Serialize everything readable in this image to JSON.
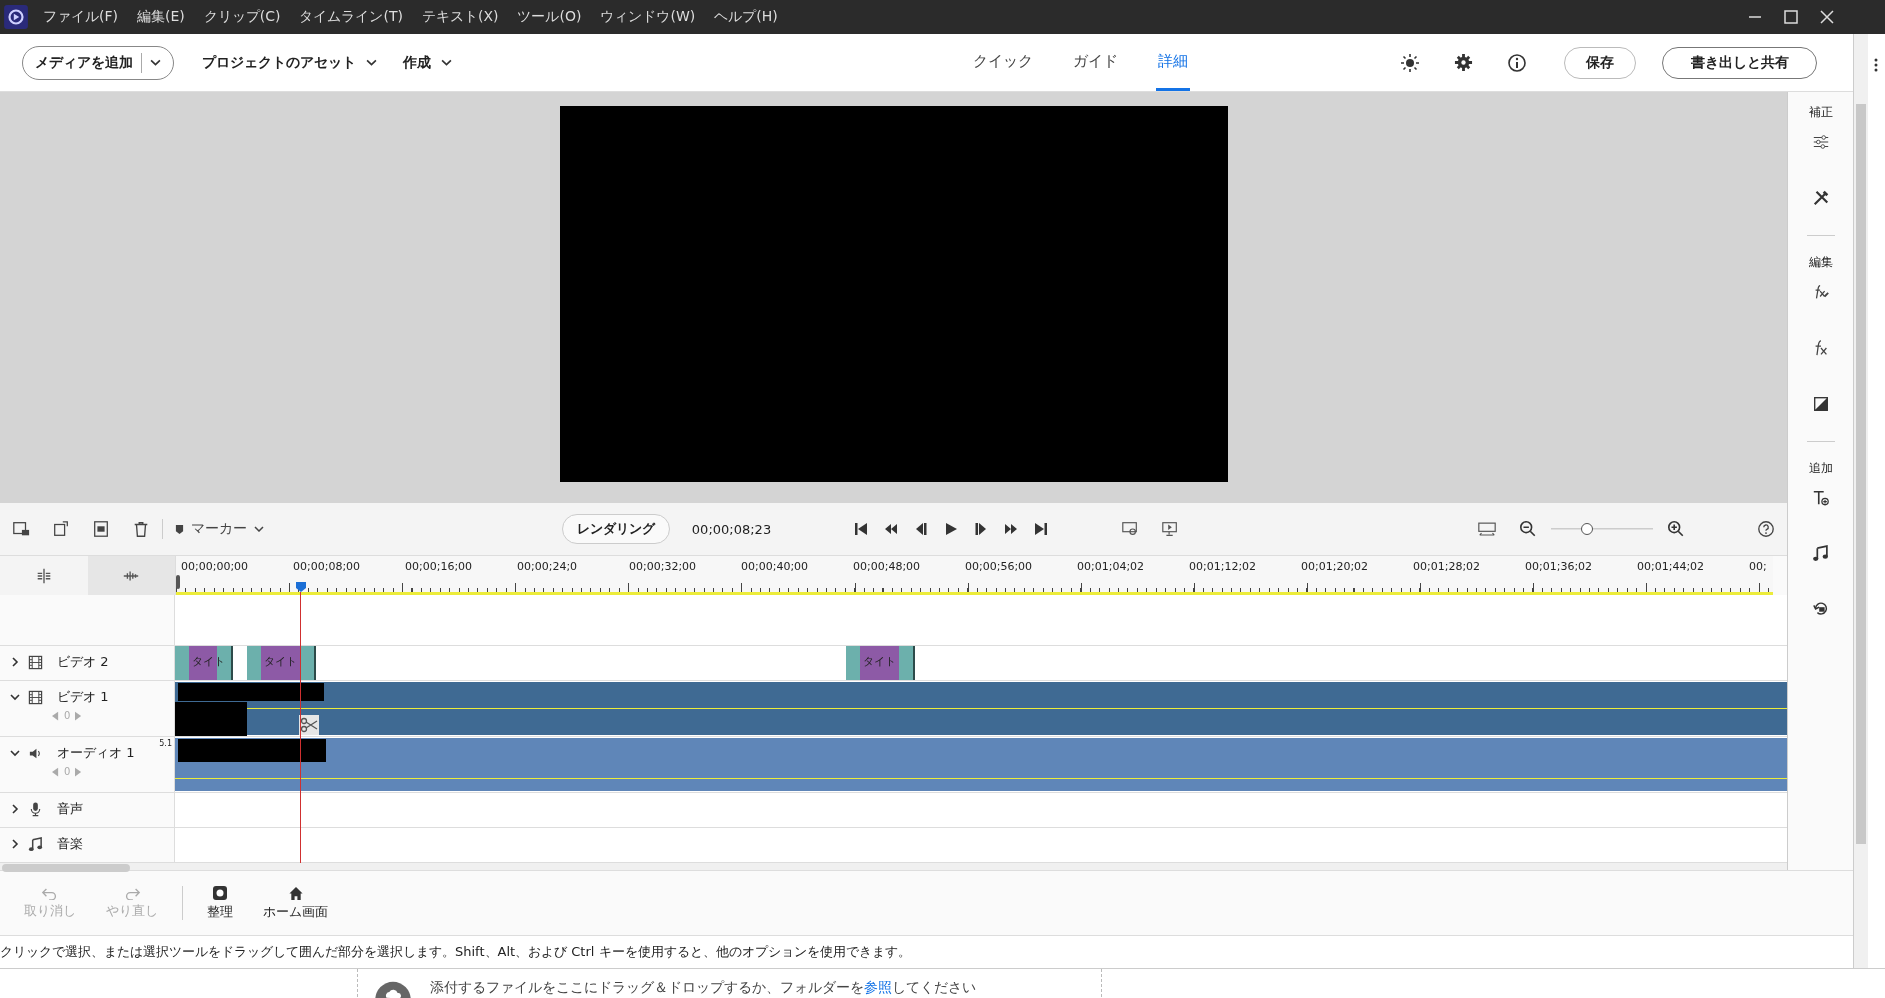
{
  "menu_bar": {
    "items": [
      "ファイル(F)",
      "編集(E)",
      "クリップ(C)",
      "タイムライン(T)",
      "テキスト(X)",
      "ツール(O)",
      "ウィンドウ(W)",
      "ヘルプ(H)"
    ]
  },
  "toolbar": {
    "add_media": "メディアを追加",
    "project_assets": "プロジェクトのアセット",
    "create": "作成",
    "save": "保存",
    "export": "書き出しと共有"
  },
  "mode_tabs": [
    {
      "label": "クイック",
      "selected": false
    },
    {
      "label": "ガイド",
      "selected": false
    },
    {
      "label": "詳細",
      "selected": true
    }
  ],
  "right_panel": {
    "sections": [
      {
        "label": "補正",
        "tools": [
          {
            "kind": "sliders"
          },
          {
            "kind": "tools"
          }
        ]
      },
      {
        "label": "編集",
        "tools": [
          {
            "kind": "fx-pen"
          },
          {
            "kind": "fx"
          },
          {
            "kind": "contrast"
          }
        ]
      },
      {
        "label": "追加",
        "tools": [
          {
            "kind": "text"
          },
          {
            "kind": "music"
          },
          {
            "kind": "rotate"
          }
        ]
      }
    ]
  },
  "timeline_toolbar": {
    "marker": "マーカー",
    "render": "レンダリング",
    "timecode": "00;00;08;23",
    "zoom": {
      "level": 0.35
    }
  },
  "ruler": [
    "00;00;00;00",
    "00;00;08;00",
    "00;00;16;00",
    "00;00;24;0",
    "00;00;32;00",
    "00;00;40;00",
    "00;00;48;00",
    "00;00;56;00",
    "00;01;04;02",
    "00;01;12;02",
    "00;01;20;02",
    "00;01;28;02",
    "00;01;36;02",
    "00;01;44;02",
    "00;"
  ],
  "tracks": [
    {
      "kind": "video",
      "name": "ビデオ 2",
      "expanded": false,
      "clips": [
        {
          "label": "タイト"
        },
        {
          "label": "タイト"
        },
        {
          "label": "タイト"
        }
      ]
    },
    {
      "kind": "video",
      "name": "ビデオ 1",
      "expanded": true,
      "level_value": "0"
    },
    {
      "kind": "audio",
      "name": "オーディオ 1",
      "expanded": true,
      "level_value": "0",
      "channels": "5.1"
    },
    {
      "kind": "voice",
      "name": "音声",
      "expanded": false
    },
    {
      "kind": "music",
      "name": "音楽",
      "expanded": false
    }
  ],
  "bottom_bar": [
    {
      "kind": "undo",
      "label": "取り消し",
      "disabled": true
    },
    {
      "kind": "redo",
      "label": "やり直し",
      "disabled": true
    },
    {
      "kind": "organizer",
      "label": "整理",
      "disabled": false
    },
    {
      "kind": "home",
      "label": "ホーム画面",
      "disabled": false
    }
  ],
  "status_bar": "クリックで選択、または選択ツールをドラッグして囲んだ部分を選択します。Shift、Alt、および Ctrl キーを使用すると、他のオプションを使用できます。",
  "drop_area": {
    "text_before": "添付するファイルをここにドラッグ＆ドロップするか、フォルダーを",
    "link": "参照",
    "text_after": "してください"
  }
}
